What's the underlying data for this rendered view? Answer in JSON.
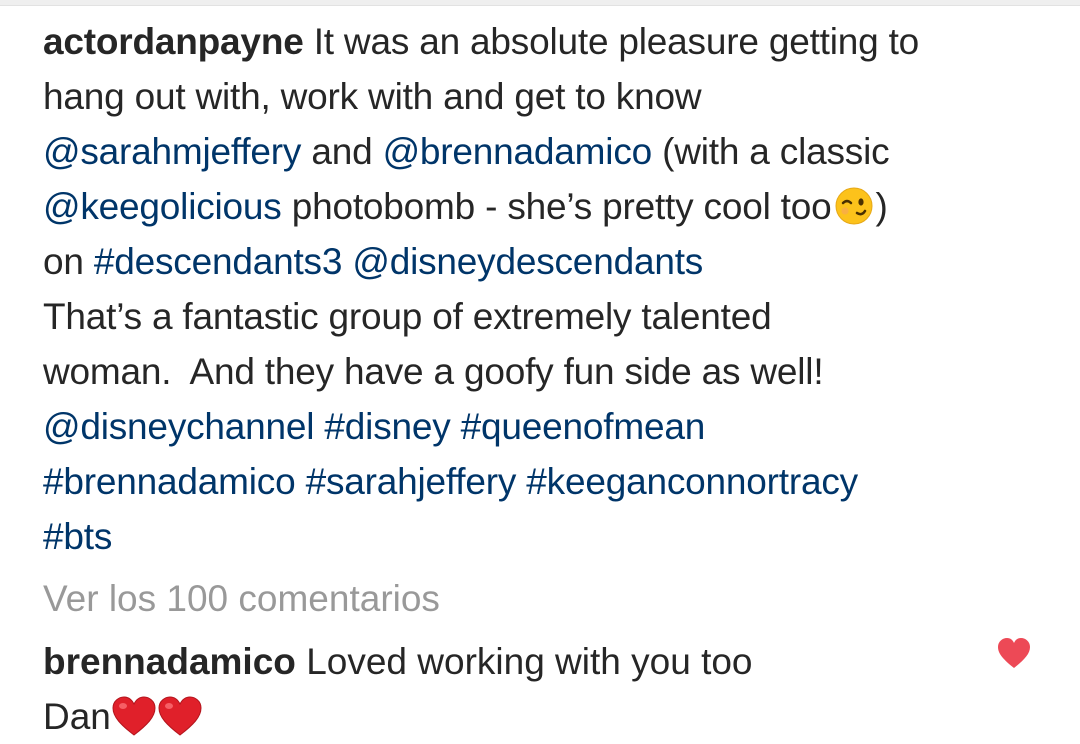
{
  "caption": {
    "username": "actordanpayne",
    "line1_text": "It was an absolute pleasure getting to",
    "line2_text": "hang out with, work with and get to know",
    "line3_mention1": "@sarahmjeffery",
    "line3_and": "and",
    "line3_mention2": "@brennadamico",
    "line3_text": "(with a classic",
    "line4_mention": "@keegolicious",
    "line4_text": "photobomb - she’s pretty cool too",
    "line4_emoji": "winking-face-emoji",
    "line4_close": ")",
    "line5_on": "on",
    "line5_tag": "#descendants3",
    "line5_mention": "@disneydescendants",
    "line6_text": "That’s a fantastic group of extremely talented",
    "line7_text": "woman.  And they have a goofy fun side as well!",
    "line8_mention": "@disneychannel",
    "line8_tag1": "#disney",
    "line8_tag2": "#queenofmean",
    "line9_tag1": "#brennadamico",
    "line9_tag2": "#sarahjeffery",
    "line9_tag3": "#keeganconnortracy",
    "line10_tag": "#bts"
  },
  "view_comments": "Ver los 100 comentarios",
  "comment": {
    "username": "brennadamico",
    "text_line1": "Loved working with you too",
    "text_line2": "Dan",
    "emojis": [
      "red-heart-emoji",
      "red-heart-emoji"
    ],
    "like_icon": "heart-icon",
    "like_color": "#ed4956"
  },
  "colors": {
    "text": "#262626",
    "link": "#003569",
    "muted": "#999999",
    "heart": "#ed4956"
  }
}
